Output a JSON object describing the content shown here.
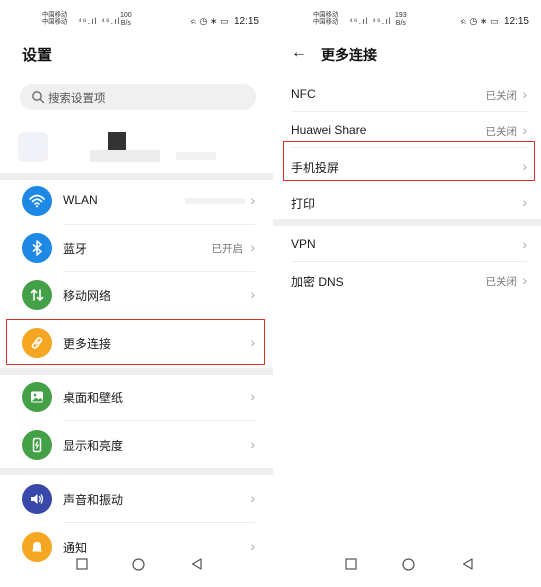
{
  "left": {
    "status": {
      "carrier_line1": "中国移动",
      "carrier_line2": "中国移动",
      "signal_text": "⁴⁶.ıl ⁴⁶.ıl",
      "speed_value": "100",
      "speed_unit": "B/s",
      "right_icons": "ᨑ ◷ ∗ ▭",
      "time": "12:15"
    },
    "title": "设置",
    "search": {
      "placeholder": "搜索设置项"
    },
    "rows": [
      {
        "label": "WLAN",
        "value": ""
      },
      {
        "label": "蓝牙",
        "value": "已开启"
      },
      {
        "label": "移动网络",
        "value": ""
      },
      {
        "label": "更多连接",
        "value": ""
      },
      {
        "label": "桌面和壁纸",
        "value": ""
      },
      {
        "label": "显示和亮度",
        "value": ""
      },
      {
        "label": "声音和振动",
        "value": ""
      },
      {
        "label": "通知",
        "value": ""
      }
    ]
  },
  "right": {
    "status": {
      "carrier_line1": "中国移动",
      "carrier_line2": "中国移动",
      "signal_text": "⁴⁶.ıl ⁴⁶.ıl",
      "speed_value": "193",
      "speed_unit": "B/s",
      "right_icons": "ᨑ ◷ ∗ ▭",
      "time": "12:15"
    },
    "back": "←",
    "title": "更多连接",
    "rows": [
      {
        "label": "NFC",
        "value": "已关闭"
      },
      {
        "label": "Huawei Share",
        "value": "已关闭"
      },
      {
        "label": "手机投屏",
        "value": ""
      },
      {
        "label": "打印",
        "value": ""
      },
      {
        "label": "VPN",
        "value": ""
      },
      {
        "label": "加密 DNS",
        "value": "已关闭"
      }
    ]
  },
  "chevron": "›",
  "icon_colors": {
    "wlan": "#1e88e5",
    "bluetooth": "#1e88e5",
    "mobile": "#43a047",
    "more": "#f5a623",
    "desktop": "#43a047",
    "display": "#43a047",
    "sound": "#3949ab",
    "notify": "#f5a623"
  },
  "highlight_color": "#d9342b"
}
